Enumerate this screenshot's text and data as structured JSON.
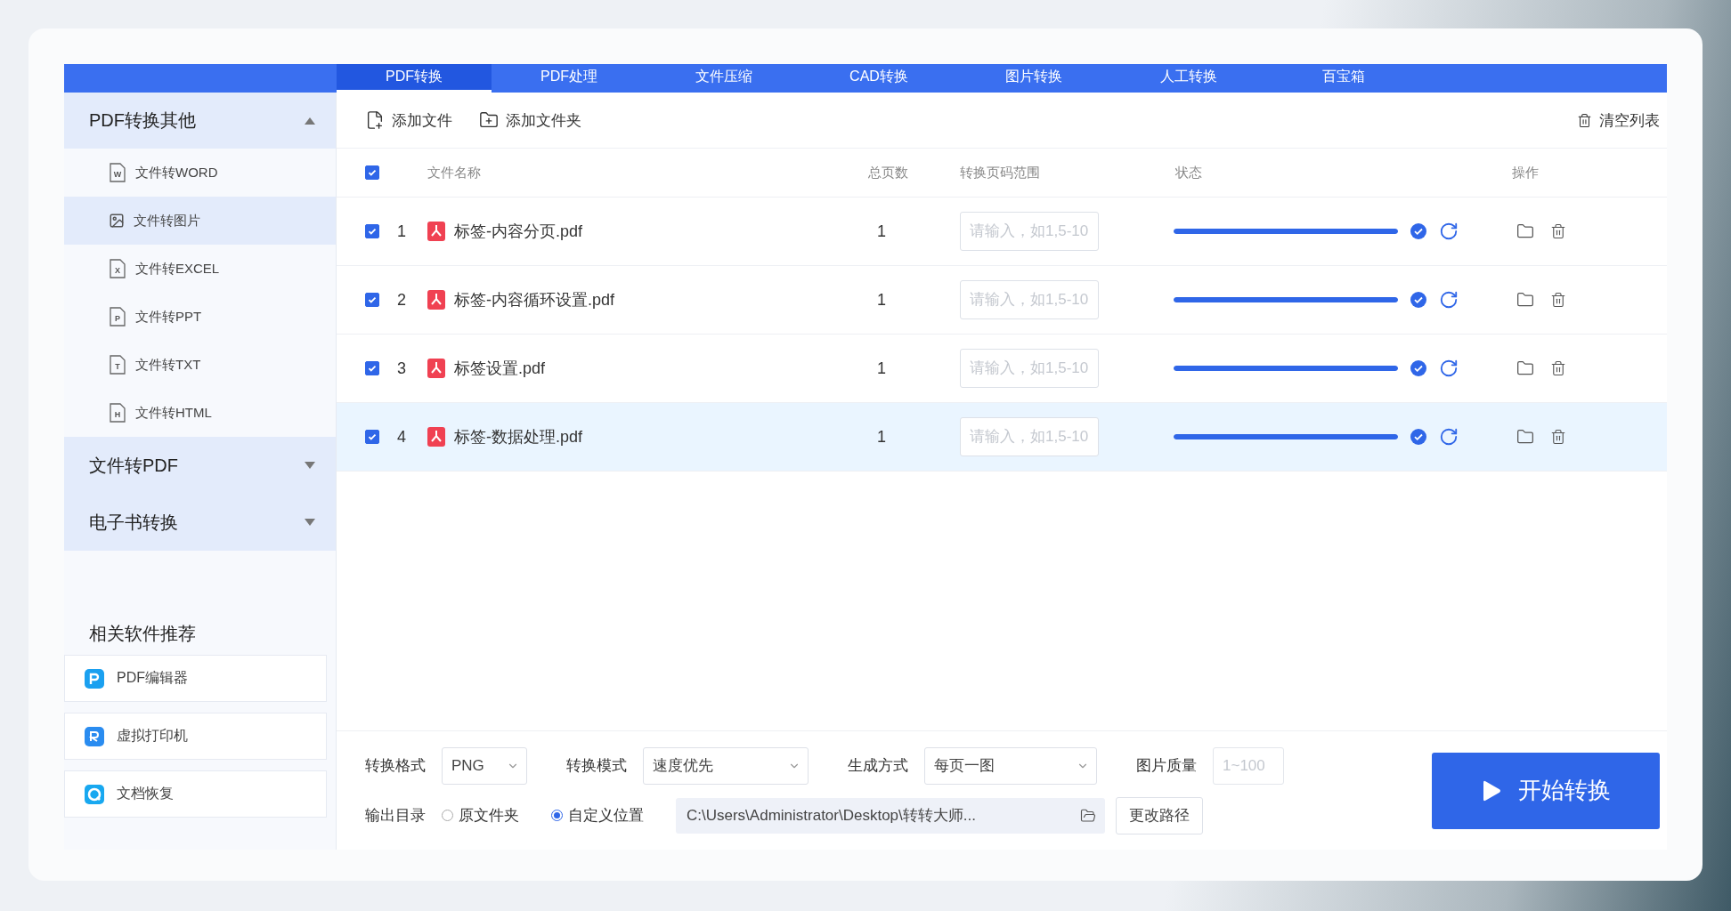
{
  "tabs": [
    {
      "label": "PDF转换",
      "selected": true
    },
    {
      "label": "PDF处理",
      "selected": false
    },
    {
      "label": "文件压缩",
      "selected": false
    },
    {
      "label": "CAD转换",
      "selected": false
    },
    {
      "label": "图片转换",
      "selected": false
    },
    {
      "label": "人工转换",
      "selected": false
    },
    {
      "label": "百宝箱",
      "selected": false
    }
  ],
  "sidebar": {
    "groups": [
      {
        "label": "PDF转换其他",
        "expanded": true,
        "items": [
          {
            "label": "文件转WORD",
            "kind": "letter",
            "badge": "W",
            "selected": false
          },
          {
            "label": "文件转图片",
            "kind": "image",
            "selected": true
          },
          {
            "label": "文件转EXCEL",
            "kind": "letter",
            "badge": "X",
            "selected": false
          },
          {
            "label": "文件转PPT",
            "kind": "letter",
            "badge": "P",
            "selected": false
          },
          {
            "label": "文件转TXT",
            "kind": "letter",
            "badge": "T",
            "selected": false
          },
          {
            "label": "文件转HTML",
            "kind": "letter",
            "badge": "H",
            "selected": false
          }
        ]
      },
      {
        "label": "文件转PDF",
        "expanded": false
      },
      {
        "label": "电子书转换",
        "expanded": false
      }
    ],
    "recommend_title": "相关软件推荐",
    "recommend": [
      {
        "label": "PDF编辑器",
        "kind": "editor"
      },
      {
        "label": "虚拟打印机",
        "kind": "printer"
      },
      {
        "label": "文档恢复",
        "kind": "recovery"
      }
    ]
  },
  "toolbar": {
    "add_file": "添加文件",
    "add_folder": "添加文件夹",
    "clear": "清空列表"
  },
  "table": {
    "all_checked": true,
    "columns": [
      "文件名称",
      "总页数",
      "转换页码范围",
      "状态",
      "操作"
    ],
    "rows": [
      {
        "checked": true,
        "index": "1",
        "name": "标签-内容分页.pdf",
        "pages": "1",
        "range_placeholder": "请输入，如1,5-10",
        "level": 1,
        "selected": false
      },
      {
        "checked": true,
        "index": "2",
        "name": "标签-内容循环设置.pdf",
        "pages": "1",
        "range_placeholder": "请输入，如1,5-10",
        "level": 1,
        "selected": false
      },
      {
        "checked": true,
        "index": "3",
        "name": "标签设置.pdf",
        "pages": "1",
        "range_placeholder": "请输入，如1,5-10",
        "level": 1,
        "selected": false
      },
      {
        "checked": true,
        "index": "4",
        "name": "标签-数据处理.pdf",
        "pages": "1",
        "range_placeholder": "请输入，如1,5-10",
        "level": 1,
        "selected": true
      }
    ]
  },
  "settings": {
    "format_label": "转换格式",
    "format": "PNG",
    "mode_label": "转换模式",
    "mode": "速度优先",
    "generate_label": "生成方式",
    "generate": "每页一图",
    "quality_label": "图片质量",
    "quality_placeholder": "1~100",
    "output_label": "输出目录",
    "output_options": [
      {
        "label": "原文件夹",
        "selected": false
      },
      {
        "label": "自定义位置",
        "selected": true
      }
    ],
    "path": "C:\\Users\\Administrator\\Desktop\\转转大师...",
    "change_path": "更改路径"
  },
  "start_button": "开始转换"
}
